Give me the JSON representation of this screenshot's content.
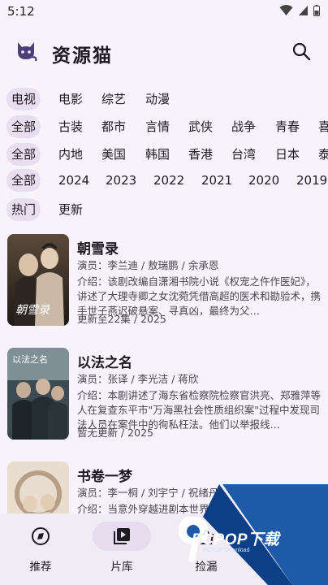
{
  "status_bar": {
    "time": "5:12"
  },
  "app": {
    "title": "资源猫"
  },
  "filters": {
    "type_row": {
      "active": "电视",
      "items": [
        "电影",
        "综艺",
        "动漫"
      ]
    },
    "genre_row": {
      "active": "全部",
      "items": [
        "古装",
        "都市",
        "言情",
        "武侠",
        "战争",
        "青春",
        "喜"
      ]
    },
    "region_row": {
      "active": "全部",
      "items": [
        "内地",
        "美国",
        "韩国",
        "香港",
        "台湾",
        "日本",
        "泰"
      ]
    },
    "year_row": {
      "active": "全部",
      "items": [
        "2024",
        "2023",
        "2022",
        "2021",
        "2020",
        "2019"
      ]
    },
    "sort_row": {
      "active": "热门",
      "items": [
        "更新"
      ]
    }
  },
  "list": [
    {
      "title": "朝雪录",
      "cast": "演员：李兰迪 / 敖瑞鹏 / 余承恩",
      "desc": "介绍：该剧改编自潇湘书院小说《权宠之仵作医妃》，讲述了大理寺卿之女沈菀凭借高超的医术和勘验术，携手世子燕迟破悬案、寻真凶，最终为父…",
      "status": "更新至22集 / 2025",
      "poster_text": "朝雪录"
    },
    {
      "title": "以法之名",
      "cast": "演员：张译 / 李光洁 / 蒋欣",
      "desc": "介绍：本剧讲述了海东省检察院检察官洪亮、郑雅萍等人在复查东平市\"万海黑社会性质组织案\"过程中发现司法人员在案件中的徇私枉法。他们以举报线…",
      "status": "暂无更新 / 2025",
      "poster_text": "以法之名"
    },
    {
      "title": "书卷一梦",
      "cast": "演员：李一桐 / 刘宇宁 / 祝绪丹",
      "desc": "介绍：当意外穿越进剧本世界，成…",
      "status": "",
      "poster_text": ""
    }
  ],
  "bottom_nav": [
    {
      "label": "推荐",
      "icon": "recommend-icon",
      "active": false
    },
    {
      "label": "片库",
      "icon": "library-icon",
      "active": true
    },
    {
      "label": "捡漏",
      "icon": "pickup-icon",
      "active": false
    }
  ],
  "watermark": {
    "text": "PCPOP下载",
    "sub": "PCPOP Download"
  }
}
